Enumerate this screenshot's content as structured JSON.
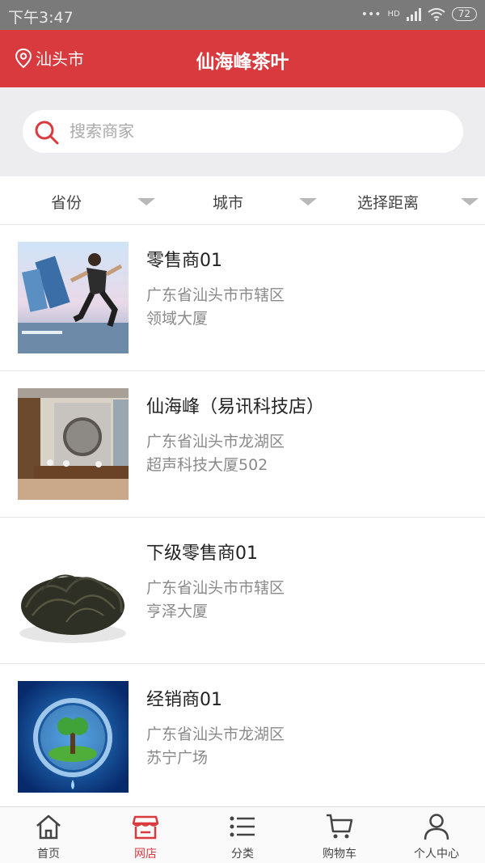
{
  "status_bar": {
    "time": "下午3:47",
    "network": "HD",
    "battery": "72"
  },
  "header": {
    "city": "汕头市",
    "title": "仙海峰茶叶"
  },
  "search": {
    "placeholder": "搜索商家"
  },
  "filters": [
    {
      "label": "省份"
    },
    {
      "label": "城市"
    },
    {
      "label": "选择距离"
    }
  ],
  "shops": [
    {
      "name": "零售商01",
      "address_line1": "广东省汕头市市辖区",
      "address_line2": "领域大厦"
    },
    {
      "name": "仙海峰（易讯科技店）",
      "address_line1": "广东省汕头市龙湖区",
      "address_line2": "超声科技大厦502"
    },
    {
      "name": "下级零售商01",
      "address_line1": "广东省汕头市市辖区",
      "address_line2": "亨泽大厦"
    },
    {
      "name": "经销商01",
      "address_line1": "广东省汕头市龙湖区",
      "address_line2": "苏宁广场"
    }
  ],
  "bottom_nav": {
    "active": "网店",
    "items": [
      {
        "label": "首页",
        "icon": "home-icon"
      },
      {
        "label": "网店",
        "icon": "store-icon"
      },
      {
        "label": "分类",
        "icon": "list-icon"
      },
      {
        "label": "购物车",
        "icon": "cart-icon"
      },
      {
        "label": "个人中心",
        "icon": "user-icon"
      }
    ]
  },
  "colors": {
    "accent": "#d83a3e",
    "status_bar": "#7a7a7a",
    "search_bg": "#ededf0"
  }
}
